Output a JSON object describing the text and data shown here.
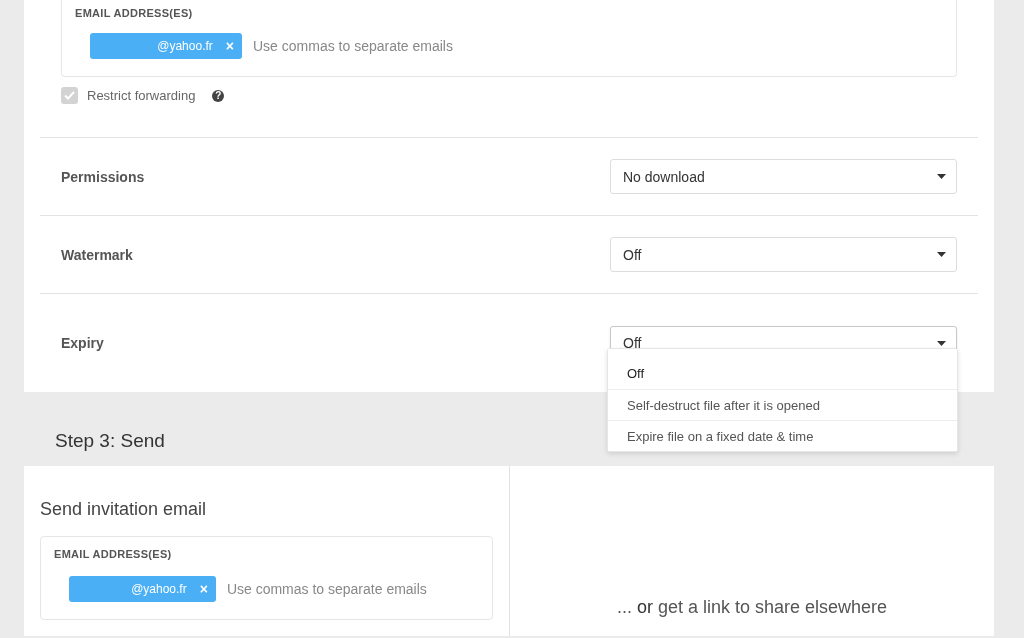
{
  "recipients": {
    "label": "EMAIL ADDRESS(ES)",
    "chips": [
      {
        "text": "@yahoo.fr",
        "remove": "×"
      }
    ],
    "placeholder": "Use commas to separate emails"
  },
  "restrict_forwarding": {
    "label": "Restrict forwarding",
    "checked": true,
    "disabled": true,
    "help": "?"
  },
  "settings": [
    {
      "label": "Permissions",
      "value": "No download",
      "expanded": false
    },
    {
      "label": "Watermark",
      "value": "Off",
      "expanded": false
    },
    {
      "label": "Expiry",
      "value": "Off",
      "expanded": true,
      "options": [
        {
          "label": "Off",
          "selected": true
        },
        {
          "label": "Self-destruct file after it is opened",
          "selected": false
        },
        {
          "label": "Expire file on a fixed date & time",
          "selected": false
        }
      ]
    }
  ],
  "step3": {
    "title": "Step 3: Send",
    "invite": {
      "title": "Send invitation email",
      "label": "EMAIL ADDRESS(ES)",
      "chips": [
        {
          "text": "@yahoo.fr",
          "remove": "×"
        }
      ],
      "placeholder": "Use commas to separate emails"
    },
    "link_text": "... **or** get a link to share elsewhere"
  }
}
